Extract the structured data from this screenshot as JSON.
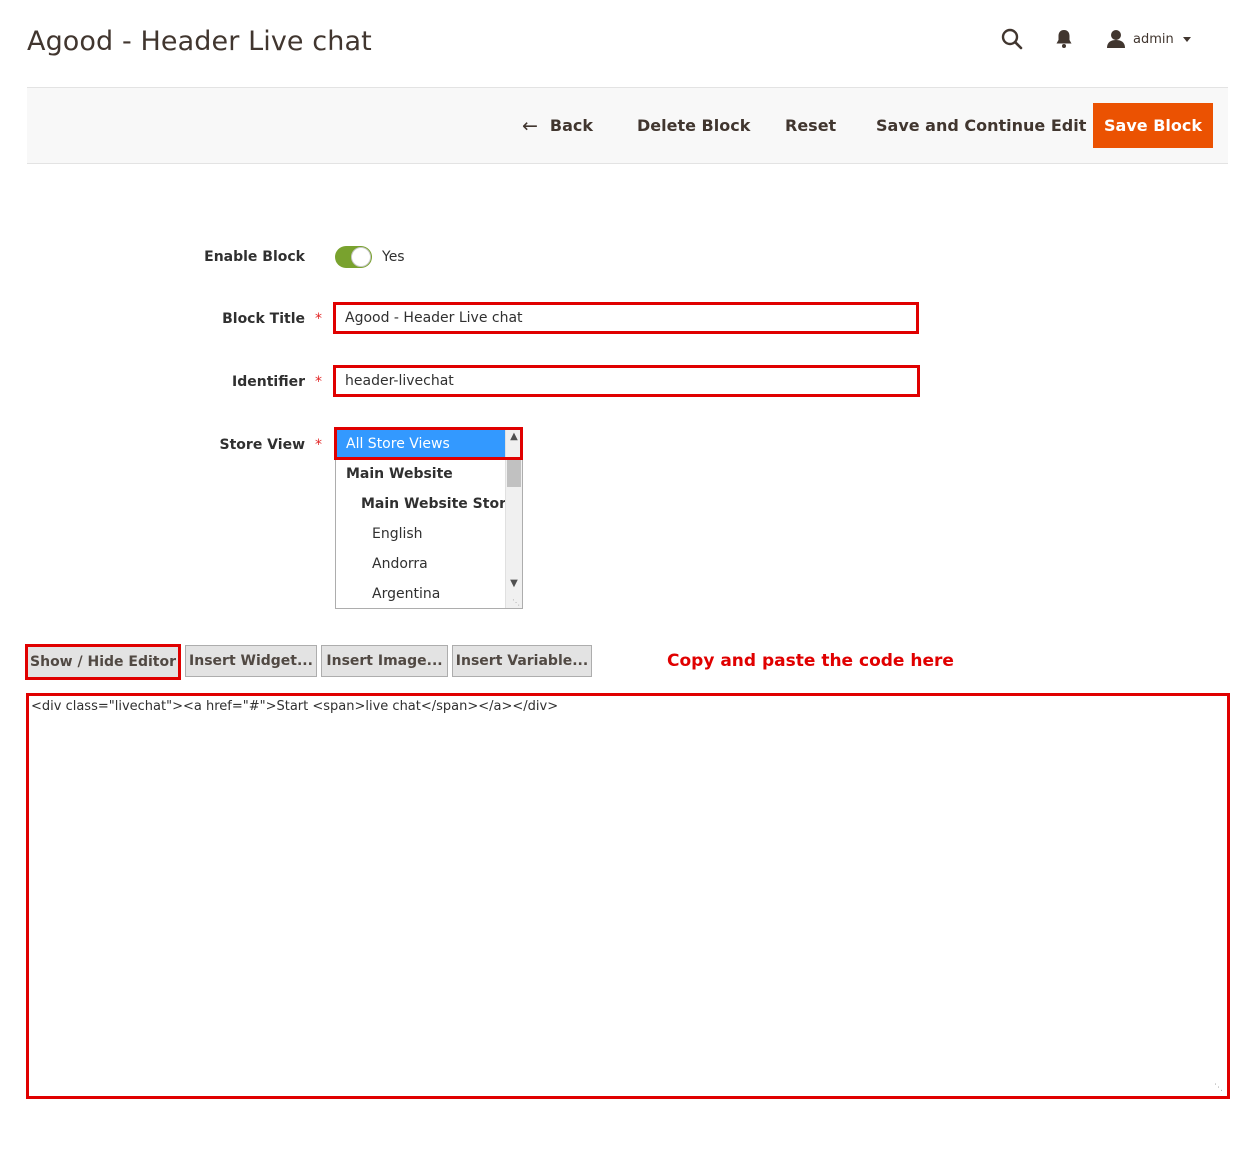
{
  "page": {
    "title": "Agood - Header Live chat"
  },
  "header": {
    "icons": [
      "search-icon",
      "bell-icon",
      "user-icon"
    ],
    "user_label": "admin"
  },
  "actions": {
    "back": "Back",
    "delete": "Delete Block",
    "reset": "Reset",
    "save_continue": "Save and Continue Edit",
    "save": "Save Block"
  },
  "form": {
    "enable": {
      "label": "Enable Block",
      "value": "Yes",
      "on": true
    },
    "title": {
      "label": "Block Title",
      "required_mark": "*",
      "value": "Agood - Header Live chat"
    },
    "identifier": {
      "label": "Identifier",
      "required_mark": "*",
      "value": "header-livechat"
    },
    "store_view": {
      "label": "Store View",
      "required_mark": "*",
      "options": [
        {
          "label": "All Store Views",
          "selected": true
        },
        {
          "label": "Main Website"
        },
        {
          "label": "Main Website Store"
        },
        {
          "label": "English"
        },
        {
          "label": "Andorra"
        },
        {
          "label": "Argentina"
        }
      ]
    }
  },
  "editor": {
    "buttons": {
      "show_hide": "Show / Hide Editor",
      "widget": "Insert Widget...",
      "image": "Insert Image...",
      "variable": "Insert Variable..."
    },
    "callout": "Copy and paste the code here",
    "content": "<div class=\"livechat\"><a href=\"#\">Start <span>live chat</span></a></div>"
  },
  "colors": {
    "accent": "#eb5202",
    "annotation_red": "#e00000",
    "toggle_on": "#79a22e",
    "selected_option": "#3399ff"
  }
}
